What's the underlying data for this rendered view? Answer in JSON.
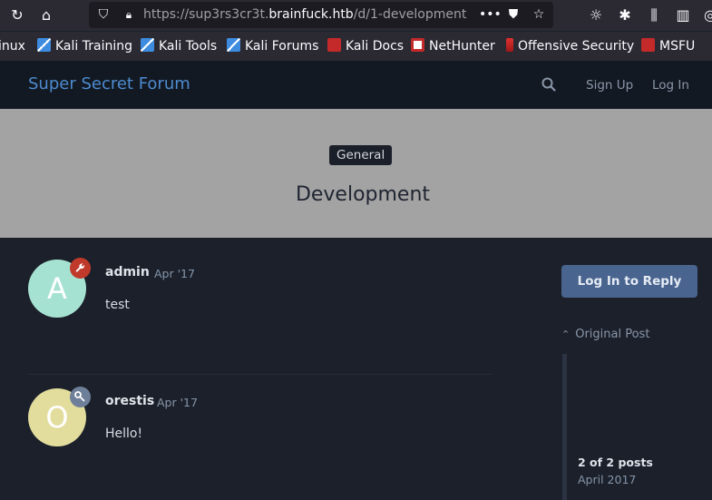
{
  "browser": {
    "url_prefix": "https://sup3rs3cr3t.",
    "url_domain": "brainfuck.htb",
    "url_path": "/d/1-development",
    "bookmarks": [
      {
        "label": "inux",
        "icon": "none"
      },
      {
        "label": "Kali Training",
        "icon": "kali-dragon-icon"
      },
      {
        "label": "Kali Tools",
        "icon": "kali-dragon-icon"
      },
      {
        "label": "Kali Forums",
        "icon": "kali-dragon-icon"
      },
      {
        "label": "Kali Docs",
        "icon": "kali-docs-icon"
      },
      {
        "label": "NetHunter",
        "icon": "nethunter-icon"
      },
      {
        "label": "Offensive Security",
        "icon": "offsec-icon"
      },
      {
        "label": "MSFU",
        "icon": "msfu-icon"
      }
    ]
  },
  "header": {
    "forum_title": "Super Secret Forum",
    "signup_label": "Sign Up",
    "login_label": "Log In"
  },
  "discussion": {
    "tag": "General",
    "title": "Development"
  },
  "posts": [
    {
      "author": "admin",
      "avatar_letter": "A",
      "avatar_color": "#a6e2d2",
      "badge_color": "#c0392b",
      "badge_icon": "wrench-icon",
      "date": "Apr '17",
      "body": "test"
    },
    {
      "author": "orestis",
      "avatar_letter": "O",
      "avatar_color": "#e2dc9d",
      "badge_color": "#6e7f99",
      "badge_icon": "key-icon",
      "date": "Apr '17",
      "body": "Hello!"
    }
  ],
  "sidebar": {
    "reply_label": "Log In to Reply",
    "original_post_label": "Original Post",
    "scrubber_count": "2 of 2 posts",
    "scrubber_date": "April 2017"
  }
}
